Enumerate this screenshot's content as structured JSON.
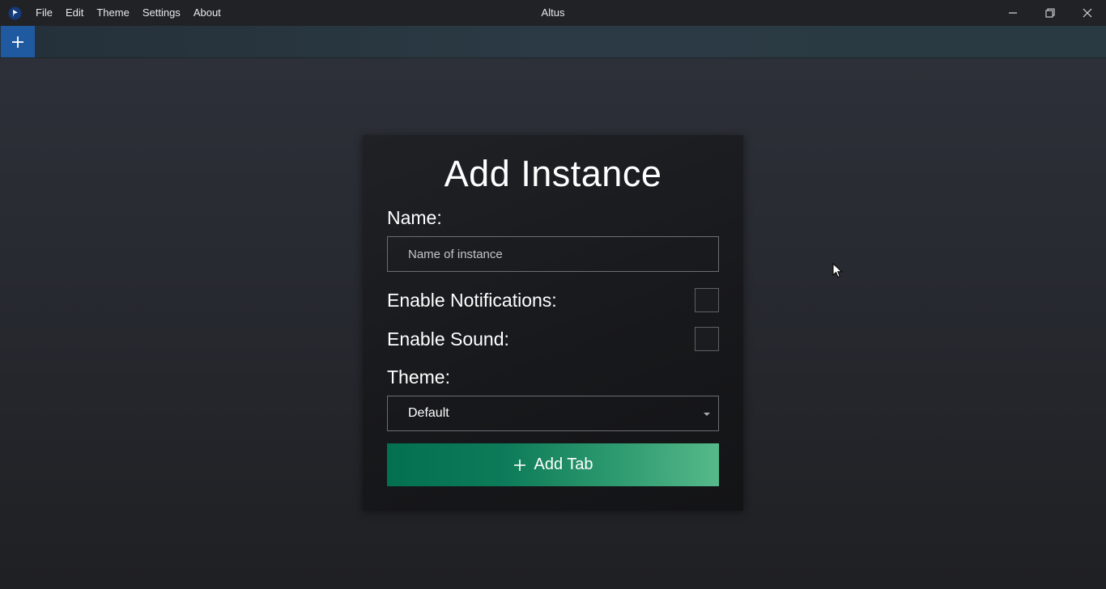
{
  "window": {
    "title": "Altus",
    "menu": [
      "File",
      "Edit",
      "Theme",
      "Settings",
      "About"
    ]
  },
  "tabbar": {
    "add_tab_icon": "plus-icon"
  },
  "dialog": {
    "title": "Add Instance",
    "name_label": "Name:",
    "name_placeholder": "Name of instance",
    "name_value": "",
    "notifications_label": "Enable Notifications:",
    "notifications_checked": false,
    "sound_label": "Enable Sound:",
    "sound_checked": false,
    "theme_label": "Theme:",
    "theme_selected": "Default",
    "add_button_label": "Add Tab"
  },
  "colors": {
    "accent_blue": "#1f5aa0",
    "button_gradient_start": "#03704f",
    "button_gradient_end": "#56b98a"
  }
}
